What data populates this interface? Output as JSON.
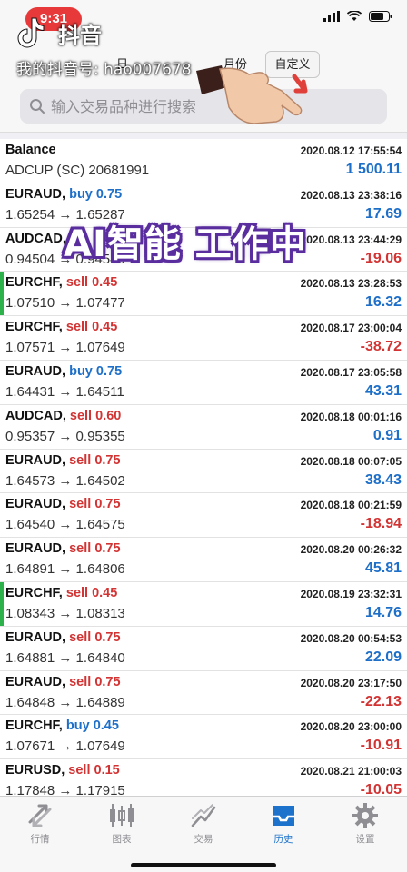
{
  "status": {
    "time": "9:31"
  },
  "watermark": {
    "app_name": "抖音",
    "user": "我的抖音号: hao007678"
  },
  "segments": {
    "day": "日",
    "month": "月份",
    "custom": "自定义"
  },
  "search": {
    "placeholder": "输入交易品种进行搜索"
  },
  "overlay_text": "AI智能 工作中",
  "rows": [
    {
      "symbol": "Balance",
      "side": "",
      "lots": "",
      "date": "2020.08.12 17:55:54",
      "price": "ADCUP (SC) 20681991",
      "profit": "1 500.11",
      "tone": "pos",
      "marker": false
    },
    {
      "symbol": "EURAUD,",
      "side": "buy",
      "lots": "0.75",
      "date": "2020.08.13 23:38:16",
      "price": "1.65254 → 1.65287",
      "profit": "17.69",
      "tone": "pos",
      "marker": false
    },
    {
      "symbol": "AUDCAD,",
      "side": "",
      "lots": "",
      "date": "2020.08.13 23:44:29",
      "price": "0.94504 → 0.94546",
      "profit": "-19.06",
      "tone": "neg",
      "marker": false
    },
    {
      "symbol": "EURCHF,",
      "side": "sell",
      "lots": "0.45",
      "date": "2020.08.13 23:28:53",
      "price": "1.07510 → 1.07477",
      "profit": "16.32",
      "tone": "pos",
      "marker": true
    },
    {
      "symbol": "EURCHF,",
      "side": "sell",
      "lots": "0.45",
      "date": "2020.08.17 23:00:04",
      "price": "1.07571 → 1.07649",
      "profit": "-38.72",
      "tone": "neg",
      "marker": false
    },
    {
      "symbol": "EURAUD,",
      "side": "buy",
      "lots": "0.75",
      "date": "2020.08.17 23:05:58",
      "price": "1.64431 → 1.64511",
      "profit": "43.31",
      "tone": "pos",
      "marker": false
    },
    {
      "symbol": "AUDCAD,",
      "side": "sell",
      "lots": "0.60",
      "date": "2020.08.18 00:01:16",
      "price": "0.95357 → 0.95355",
      "profit": "0.91",
      "tone": "pos",
      "marker": false
    },
    {
      "symbol": "EURAUD,",
      "side": "sell",
      "lots": "0.75",
      "date": "2020.08.18 00:07:05",
      "price": "1.64573 → 1.64502",
      "profit": "38.43",
      "tone": "pos",
      "marker": false
    },
    {
      "symbol": "EURAUD,",
      "side": "sell",
      "lots": "0.75",
      "date": "2020.08.18 00:21:59",
      "price": "1.64540 → 1.64575",
      "profit": "-18.94",
      "tone": "neg",
      "marker": false
    },
    {
      "symbol": "EURAUD,",
      "side": "sell",
      "lots": "0.75",
      "date": "2020.08.20 00:26:32",
      "price": "1.64891 → 1.64806",
      "profit": "45.81",
      "tone": "pos",
      "marker": false
    },
    {
      "symbol": "EURCHF,",
      "side": "sell",
      "lots": "0.45",
      "date": "2020.08.19 23:32:31",
      "price": "1.08343 → 1.08313",
      "profit": "14.76",
      "tone": "pos",
      "marker": true
    },
    {
      "symbol": "EURAUD,",
      "side": "sell",
      "lots": "0.75",
      "date": "2020.08.20 00:54:53",
      "price": "1.64881 → 1.64840",
      "profit": "22.09",
      "tone": "pos",
      "marker": false
    },
    {
      "symbol": "EURAUD,",
      "side": "sell",
      "lots": "0.75",
      "date": "2020.08.20 23:17:50",
      "price": "1.64848 → 1.64889",
      "profit": "-22.13",
      "tone": "neg",
      "marker": false
    },
    {
      "symbol": "EURCHF,",
      "side": "buy",
      "lots": "0.45",
      "date": "2020.08.20 23:00:00",
      "price": "1.07671 → 1.07649",
      "profit": "-10.91",
      "tone": "neg",
      "marker": false
    },
    {
      "symbol": "EURUSD,",
      "side": "sell",
      "lots": "0.15",
      "date": "2020.08.21 21:00:03",
      "price": "1.17848 → 1.17915",
      "profit": "-10.05",
      "tone": "neg",
      "marker": false
    }
  ],
  "tabs": [
    {
      "label": "行情",
      "icon": "quotes-icon",
      "active": false
    },
    {
      "label": "图表",
      "icon": "chart-icon",
      "active": false
    },
    {
      "label": "交易",
      "icon": "trade-icon",
      "active": false
    },
    {
      "label": "历史",
      "icon": "history-icon",
      "active": true
    },
    {
      "label": "设置",
      "icon": "settings-icon",
      "active": false
    }
  ],
  "colors": {
    "buy": "#1e6fc8",
    "sell": "#d23434",
    "active_tab": "#1d73cc",
    "marker": "#2db14a"
  }
}
